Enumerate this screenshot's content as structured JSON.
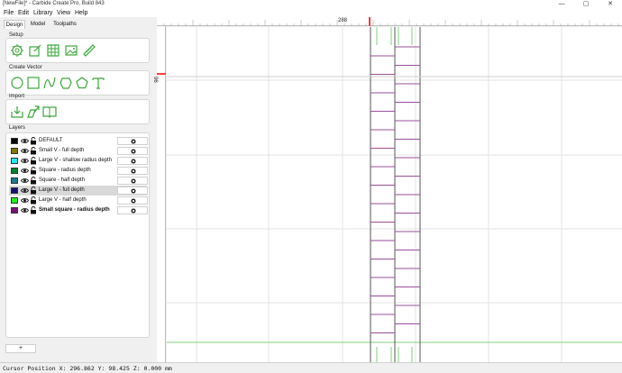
{
  "window": {
    "title": "[NewFile]* - Carbide Create Pro, Build 843",
    "controls": [
      "—",
      "▢",
      "✕"
    ]
  },
  "menu": [
    "File",
    "Edit",
    "Library",
    "View",
    "Help"
  ],
  "tabs": [
    {
      "label": "Design",
      "active": true
    },
    {
      "label": "Model",
      "active": false
    },
    {
      "label": "Toolpaths",
      "active": false
    }
  ],
  "sections": {
    "setup": "Setup",
    "create_vector": "Create Vector",
    "import": "Import",
    "layers": "Layers"
  },
  "setup_tools": [
    "job-setup-icon",
    "edit-icon",
    "grid-icon",
    "image-icon",
    "ruler-icon"
  ],
  "vector_tools": [
    "circle-icon",
    "rectangle-icon",
    "curve-icon",
    "polygon-shape-icon",
    "pentagon-icon",
    "text-icon"
  ],
  "import_tools": [
    "import-icon",
    "import-image-icon",
    "library-book-icon"
  ],
  "layers": [
    {
      "name": "DEFAULT",
      "color": "#000000",
      "bold": false,
      "selected": false
    },
    {
      "name": "Small V - full depth",
      "color": "#7f7a00",
      "bold": false,
      "selected": false
    },
    {
      "name": "Large V - shallow radius depth",
      "color": "#27e8f0",
      "bold": false,
      "selected": false
    },
    {
      "name": "Square - radius depth",
      "color": "#00822b",
      "bold": false,
      "selected": false
    },
    {
      "name": "Square - half depth",
      "color": "#1a7a8e",
      "bold": false,
      "selected": false
    },
    {
      "name": "Large V - full depth",
      "color": "#15126e",
      "bold": false,
      "selected": true
    },
    {
      "name": "Large V - half depth",
      "color": "#1ef01e",
      "bold": false,
      "selected": false
    },
    {
      "name": "Small square - radius depth",
      "color": "#7a117a",
      "bold": true,
      "selected": false
    }
  ],
  "add_layer_label": "+",
  "ruler": {
    "top_label": "288",
    "left_label": "96"
  },
  "status": "Cursor Position X: 296.862 Y: 98.425 Z: 0.000 mm",
  "colors": {
    "cursor_marker": "#ff3b3b",
    "grid": "#e6e6e6",
    "guide": "#7fd07f",
    "shape": "#9a4f9a",
    "icon": "#3aa83a"
  }
}
